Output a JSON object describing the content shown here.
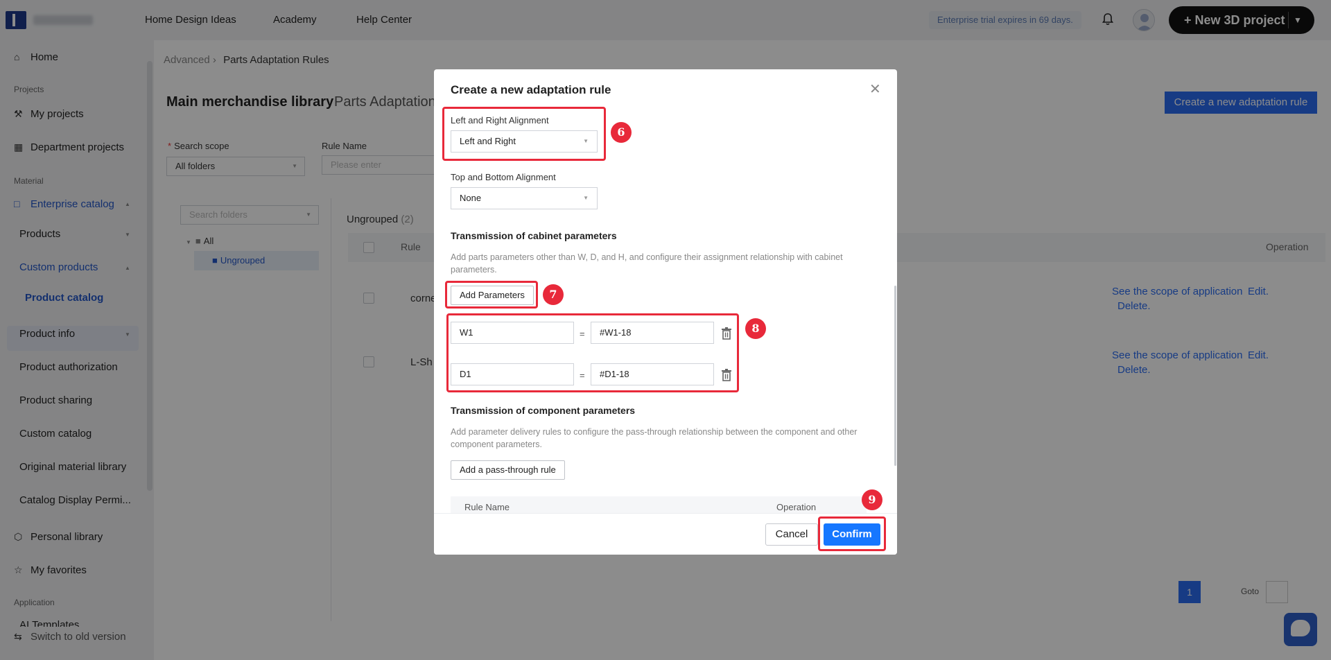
{
  "topbar": {
    "nav": [
      "Home Design Ideas",
      "Academy",
      "Help Center"
    ],
    "trial": "Enterprise trial expires in 69 days.",
    "new_project": "+ New 3D project"
  },
  "sidebar": {
    "home": "Home",
    "section_projects": "Projects",
    "my_projects": "My projects",
    "department_projects": "Department projects",
    "section_material": "Material",
    "enterprise_catalog": "Enterprise catalog",
    "products": "Products",
    "custom_products": "Custom products",
    "product_catalog": "Product catalog",
    "product_info": "Product info",
    "product_authorization": "Product authorization",
    "product_sharing": "Product sharing",
    "custom_catalog": "Custom catalog",
    "original_material_library": "Original material library",
    "catalog_display": "Catalog Display Permi...",
    "personal_library": "Personal library",
    "my_favorites": "My favorites",
    "section_application": "Application",
    "ai_templates": "AI Templates",
    "switch_old": "Switch to old version"
  },
  "main": {
    "breadcrumb_root": "Advanced",
    "breadcrumb_current": "Parts Adaptation Rules",
    "library_title": "Main merchandise library",
    "tab2": "Parts Adaptation",
    "create_button": "Create a new adaptation rule",
    "search_scope_label": "Search scope",
    "search_scope_value": "All folders",
    "rule_name_label": "Rule Name",
    "rule_name_placeholder": "Please enter",
    "search_folders_placeholder": "Search folders",
    "tree_all": "All",
    "tree_ungrouped": "Ungrouped",
    "group_title": "Ungrouped",
    "group_count": "(2)",
    "col_rule": "Rule",
    "col_operation": "Operation",
    "rows": [
      {
        "name": "corne",
        "scope": "See the scope of application",
        "edit": "Edit.",
        "delete": "Delete."
      },
      {
        "name": "L-Sh",
        "scope": "See the scope of application",
        "edit": "Edit.",
        "delete": "Delete."
      }
    ],
    "pager_current": "1",
    "goto": "Goto"
  },
  "modal": {
    "title": "Create a new adaptation rule",
    "lr_label": "Left and Right Alignment",
    "lr_value": "Left and Right",
    "tb_label": "Top and Bottom Alignment",
    "tb_value": "None",
    "cabinet_heading": "Transmission of cabinet parameters",
    "cabinet_desc": "Add parts parameters other than W, D, and H, and configure their assignment relationship with cabinet parameters.",
    "add_parameters": "Add Parameters",
    "params": [
      {
        "name": "W1",
        "eq": "=",
        "value": "#W1-18"
      },
      {
        "name": "D1",
        "eq": "=",
        "value": "#D1-18"
      }
    ],
    "component_heading": "Transmission of component parameters",
    "component_desc": "Add parameter delivery rules to configure the pass-through relationship between the component and other component parameters.",
    "add_pass_through": "Add a pass-through rule",
    "rules_col_name": "Rule Name",
    "rules_col_operation": "Operation",
    "cancel": "Cancel",
    "confirm": "Confirm"
  },
  "annotations": {
    "badge_6": "6",
    "badge_7": "7",
    "badge_8": "8",
    "badge_9": "9",
    "color": "#e8293a"
  },
  "colors": {
    "accent": "#1677ff",
    "brand_dark": "#111111",
    "link": "#2b6cf0"
  }
}
